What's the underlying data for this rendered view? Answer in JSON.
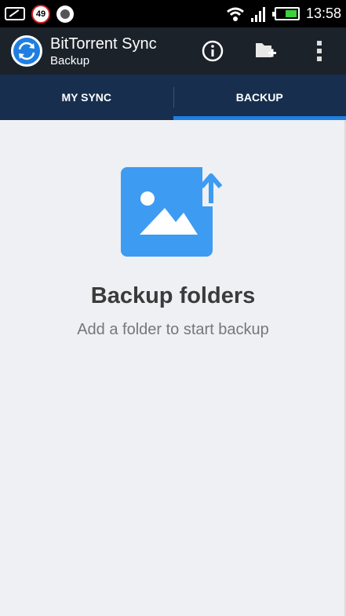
{
  "status_bar": {
    "notification_count": "49",
    "time": "13:58",
    "icons": [
      "message-icon",
      "notification-badge-icon",
      "sync-status-icon",
      "wifi-icon",
      "signal-icon",
      "battery-icon"
    ]
  },
  "app_bar": {
    "title": "BitTorrent Sync",
    "subtitle": "Backup",
    "actions": [
      {
        "name": "info-button",
        "icon": "info-icon"
      },
      {
        "name": "add-folder-button",
        "icon": "folder-add-icon"
      },
      {
        "name": "overflow-menu-button",
        "icon": "more-vert-icon"
      }
    ]
  },
  "tabs": [
    {
      "label": "MY SYNC",
      "active": false
    },
    {
      "label": "BACKUP",
      "active": true
    }
  ],
  "empty_state": {
    "icon": "image-upload-icon",
    "heading": "Backup folders",
    "subtext": "Add a folder to start backup"
  },
  "colors": {
    "accent": "#1f7fe0",
    "tab_bar": "#172e4e",
    "app_bar": "#1c222a",
    "illustration": "#3d9bf2",
    "background": "#eef0f3"
  }
}
